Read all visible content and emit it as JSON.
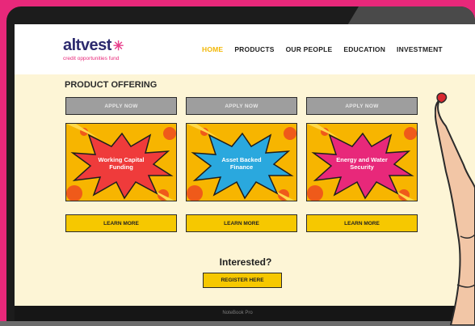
{
  "logo": {
    "name": "altvest",
    "tagline": "credit opportunities fund"
  },
  "nav": {
    "items": [
      {
        "label": "HOME",
        "active": true
      },
      {
        "label": "PRODUCTS",
        "active": false
      },
      {
        "label": "OUR PEOPLE",
        "active": false
      },
      {
        "label": "EDUCATION",
        "active": false
      },
      {
        "label": "INVESTMENT",
        "active": false
      }
    ]
  },
  "main": {
    "heading": "PRODUCT OFFERING",
    "apply_label": "APPLY NOW",
    "learn_label": "LEARN MORE",
    "product_grid": [
      {
        "line1": "Working Capital",
        "line2": "Funding",
        "burst_color": "#ef3b3b"
      },
      {
        "line1": "Asset Backed",
        "line2": "Finance",
        "burst_color": "#2aa8de"
      },
      {
        "line1": "Energy and Water",
        "line2": "Security",
        "burst_color": "#e8287a"
      }
    ],
    "cta": {
      "title": "Interested?",
      "button": "REGISTER HERE"
    }
  },
  "device": {
    "brand": "NoteBook Pro"
  },
  "colors": {
    "accent": "#f6c800",
    "brand_pink": "#e8287a",
    "navy": "#2c2a6e",
    "background": "#fdf5d6"
  }
}
